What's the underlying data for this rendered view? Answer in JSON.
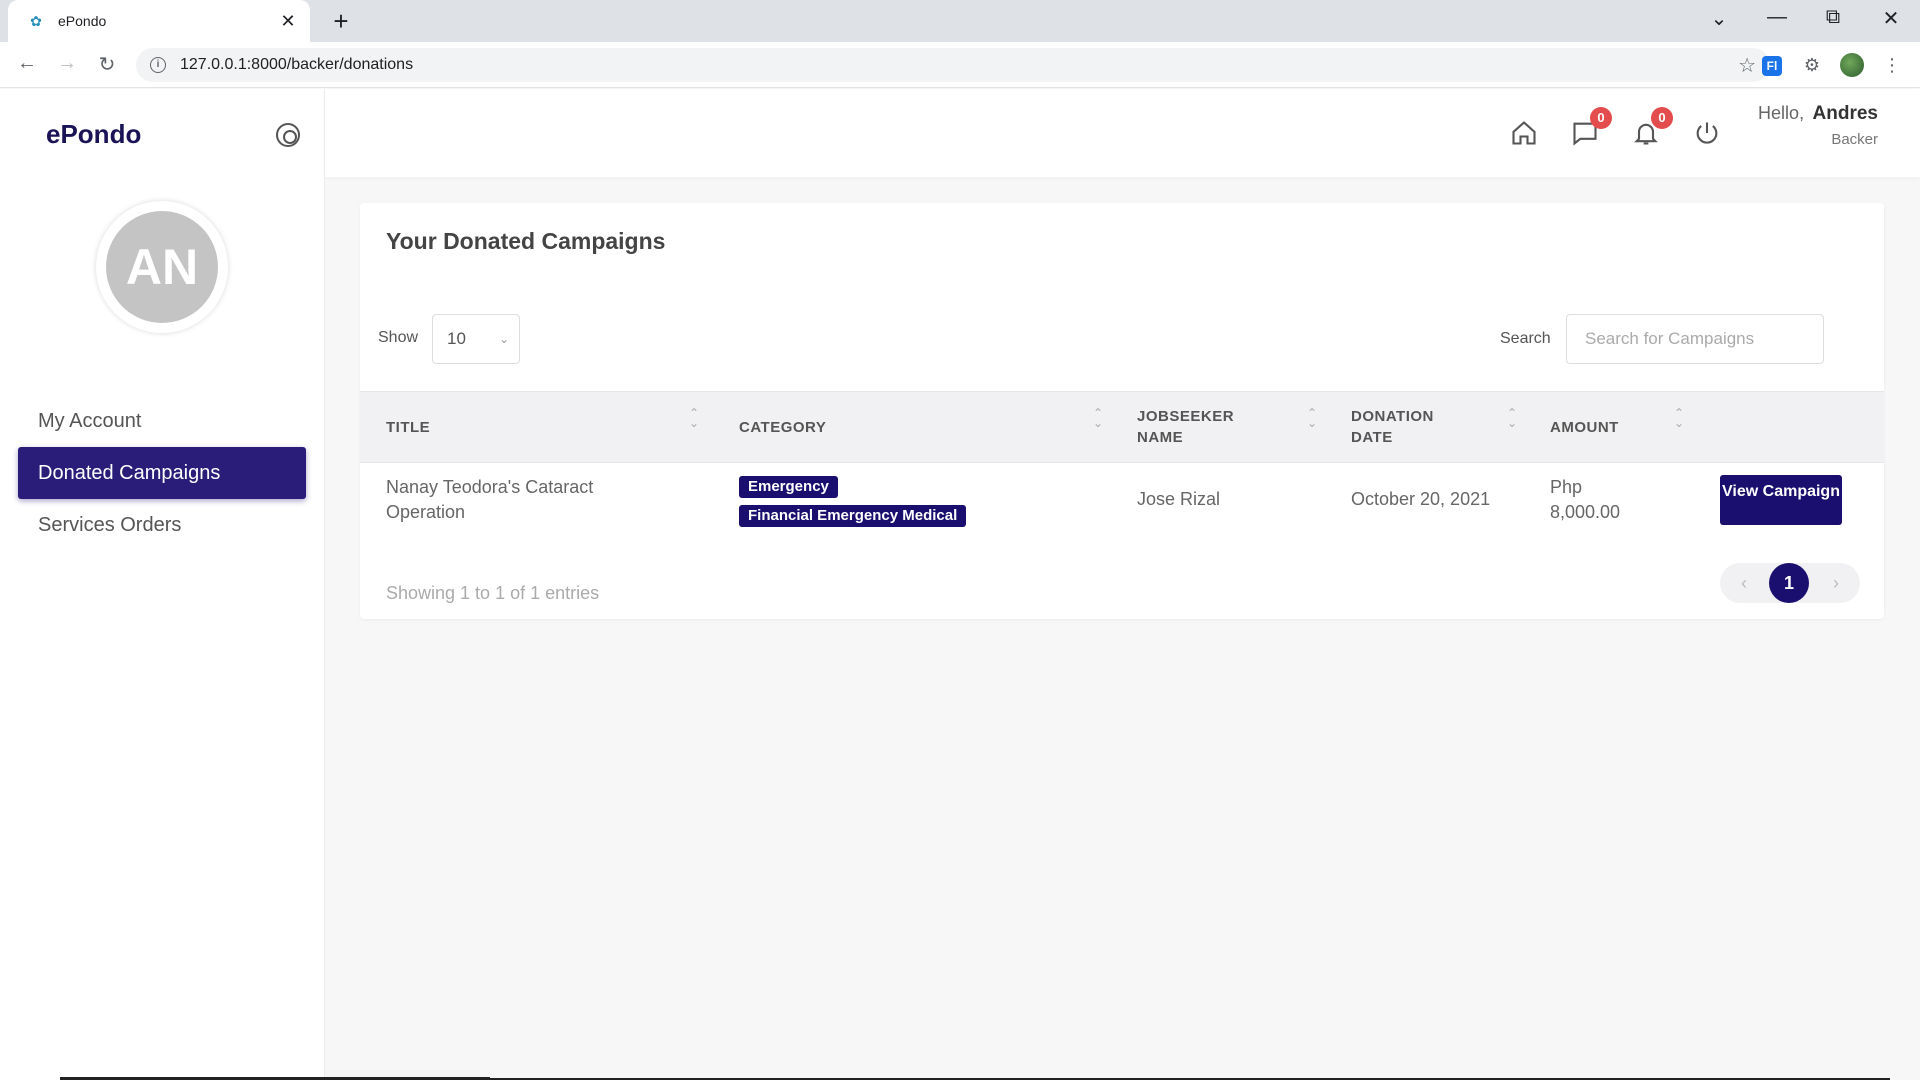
{
  "browser": {
    "tab_title": "ePondo",
    "url": "127.0.0.1:8000/backer/donations",
    "ext_label": "Fl"
  },
  "sidebar": {
    "brand": "ePondo",
    "avatar_initials": "AN",
    "items": [
      {
        "label": "My Account",
        "active": false
      },
      {
        "label": "Donated Campaigns",
        "active": true
      },
      {
        "label": "Services Orders",
        "active": false
      }
    ]
  },
  "topbar": {
    "messages_count": "0",
    "notifications_count": "0",
    "greeting": "Hello,",
    "user_name": "Andres",
    "user_role": "Backer"
  },
  "main": {
    "title": "Your Donated Campaigns",
    "show_label": "Show",
    "show_value": "10",
    "search_label": "Search",
    "search_placeholder": "Search for Campaigns",
    "columns": [
      "TITLE",
      "CATEGORY",
      "JOBSEEKER NAME",
      "DONATION DATE",
      "AMOUNT"
    ],
    "rows": [
      {
        "title": "Nanay Teodora's Cataract Operation",
        "categories": [
          "Emergency",
          "Financial Emergency Medical"
        ],
        "jobseeker": "Jose Rizal",
        "date": "October 20, 2021",
        "amount": "Php 8,000.00",
        "action": "View Campaign"
      }
    ],
    "info": "Showing 1 to 1 of 1 entries",
    "page": "1"
  },
  "colors": {
    "brand": "#1a1356",
    "accent": "#1a0f6e",
    "badge": "#e44d4d"
  }
}
